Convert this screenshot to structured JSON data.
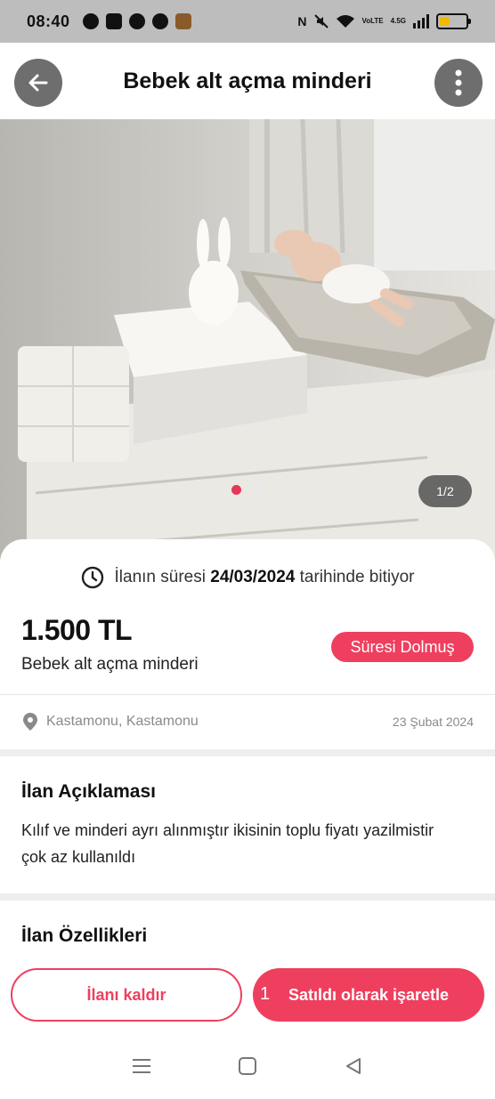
{
  "status_bar": {
    "time": "08:40",
    "app_icons": [
      "facebook-icon",
      "app-icon",
      "notification-icon",
      "pinterest-icon",
      "bookmark-app-icon"
    ],
    "network": "4.5G",
    "volte": "VoLTE"
  },
  "header": {
    "title": "Bebek alt açma minderi",
    "back_icon": "arrow-left-icon",
    "menu_icon": "more-vertical-icon"
  },
  "gallery": {
    "counter": "1/2",
    "current": 1,
    "total": 2
  },
  "listing": {
    "expiry_prefix": "İlanın süresi",
    "expiry_date": "24/03/2024",
    "expiry_suffix": "tarihinde bitiyor",
    "price": "1.500 TL",
    "name": "Bebek alt açma minderi",
    "status_badge": "Süresi Dolmuş",
    "location": "Kastamonu, Kastamonu",
    "date": "23 Şubat 2024"
  },
  "description": {
    "title": "İlan Açıklaması",
    "text": "Kılıf ve minderi ayrı alınmıştır ikisinin toplu fiyatı yazilmistir çok az kullanıldı"
  },
  "features": {
    "title": "İlan Özellikleri"
  },
  "actions": {
    "remove_label": "İlanı kaldır",
    "sold_label": "Satıldı olarak işaretle",
    "sold_badge": "1"
  },
  "colors": {
    "accent": "#ef3f5e",
    "header_button": "#6e6e6e",
    "status_bar": "#bdbdbd"
  }
}
